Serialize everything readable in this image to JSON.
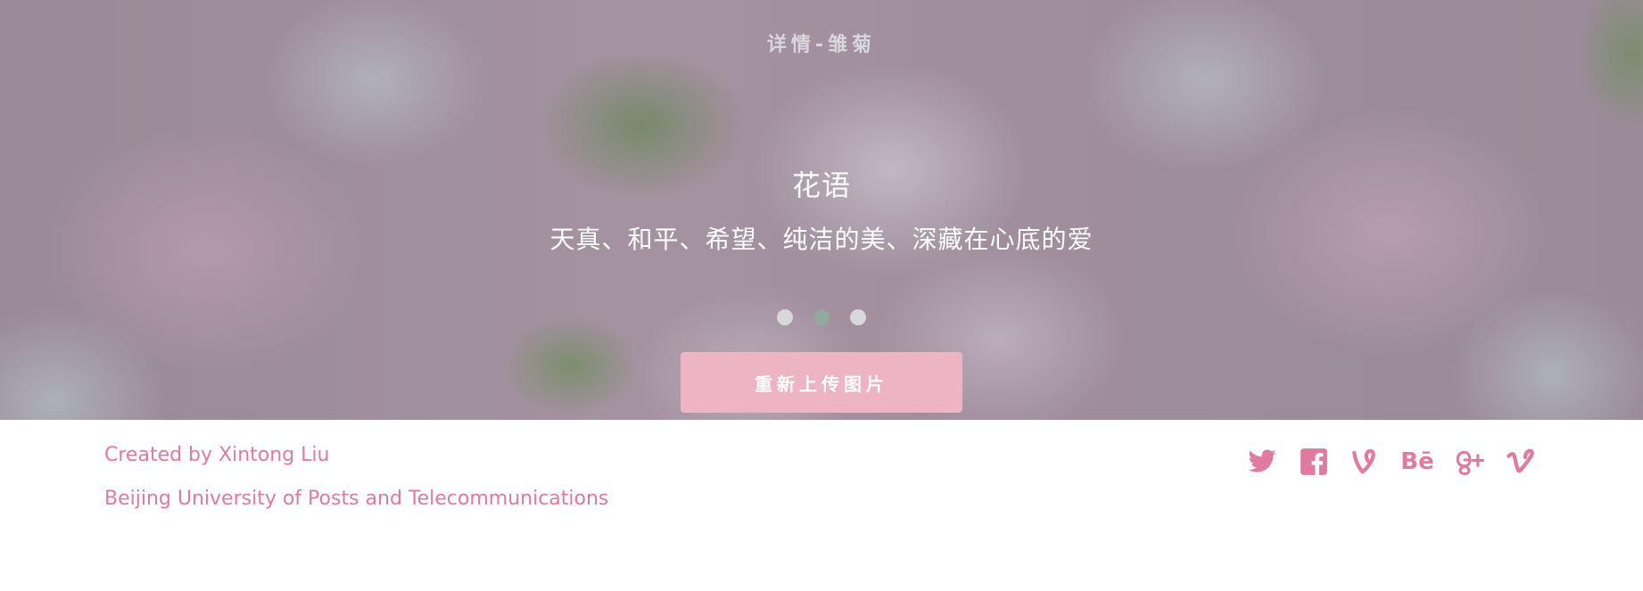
{
  "hero": {
    "page_title": "详情-雏菊",
    "section_heading": "花语",
    "flower_language": "天真、和平、希望、纯洁的美、深藏在心底的爱",
    "carousel": {
      "count": 3,
      "active_index": 1
    },
    "reupload_button": "重新上传图片"
  },
  "footer": {
    "credit_line": "Created by Xintong Liu",
    "organization_line": "Beijing University of Posts and Telecommunications",
    "social_links": [
      {
        "icon": "twitter-icon"
      },
      {
        "icon": "facebook-icon"
      },
      {
        "icon": "vine-icon"
      },
      {
        "icon": "behance-icon",
        "text": "Bē"
      },
      {
        "icon": "google-plus-icon"
      },
      {
        "icon": "vimeo-icon"
      }
    ]
  },
  "colors": {
    "accent_pink": "#e07aa0",
    "button_pink": "#edb4c3",
    "dot_inactive": "#d7d7dc",
    "dot_active": "#93a99d"
  }
}
